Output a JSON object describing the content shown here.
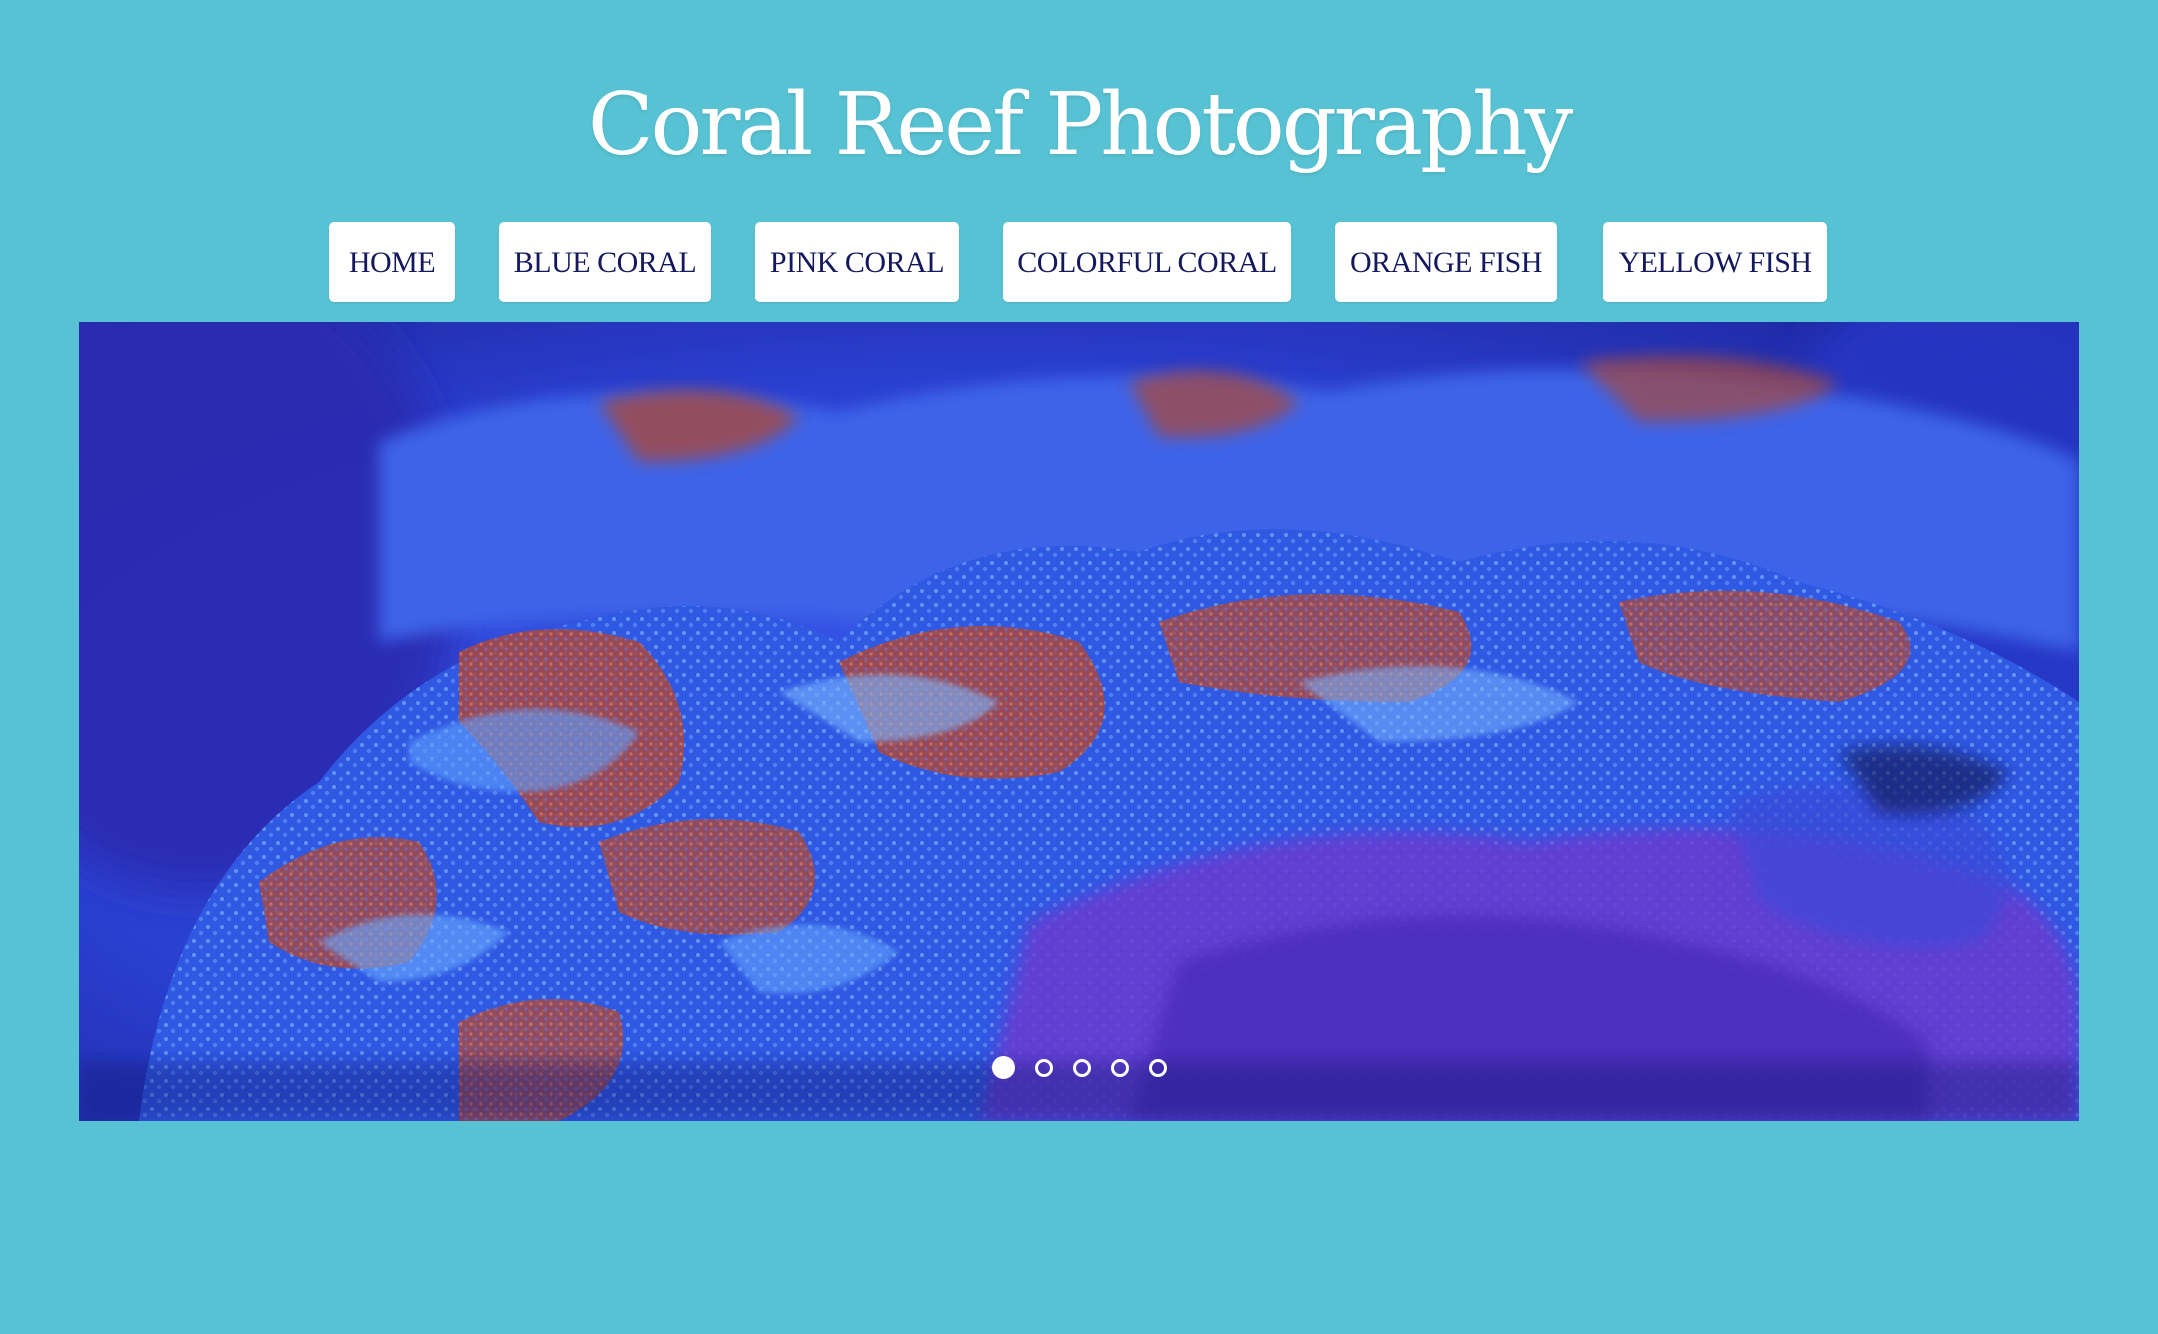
{
  "site": {
    "title": "Coral Reef Photography"
  },
  "nav": {
    "items": [
      {
        "label": "HOME"
      },
      {
        "label": "BLUE CORAL"
      },
      {
        "label": "PINK CORAL"
      },
      {
        "label": "COLORFUL CORAL"
      },
      {
        "label": "ORANGE FISH"
      },
      {
        "label": "YELLOW FISH"
      }
    ]
  },
  "slider": {
    "image": "blue-coral-photo",
    "total_slides": 5,
    "active_slide": 1
  },
  "colors": {
    "background": "#57c2d3",
    "title": "#ffffff",
    "button_bg": "#ffffff",
    "button_text": "#16185e",
    "coral_blue": "#2e55e6",
    "coral_red": "#a8483e",
    "coral_purple": "#6a3bd0"
  }
}
